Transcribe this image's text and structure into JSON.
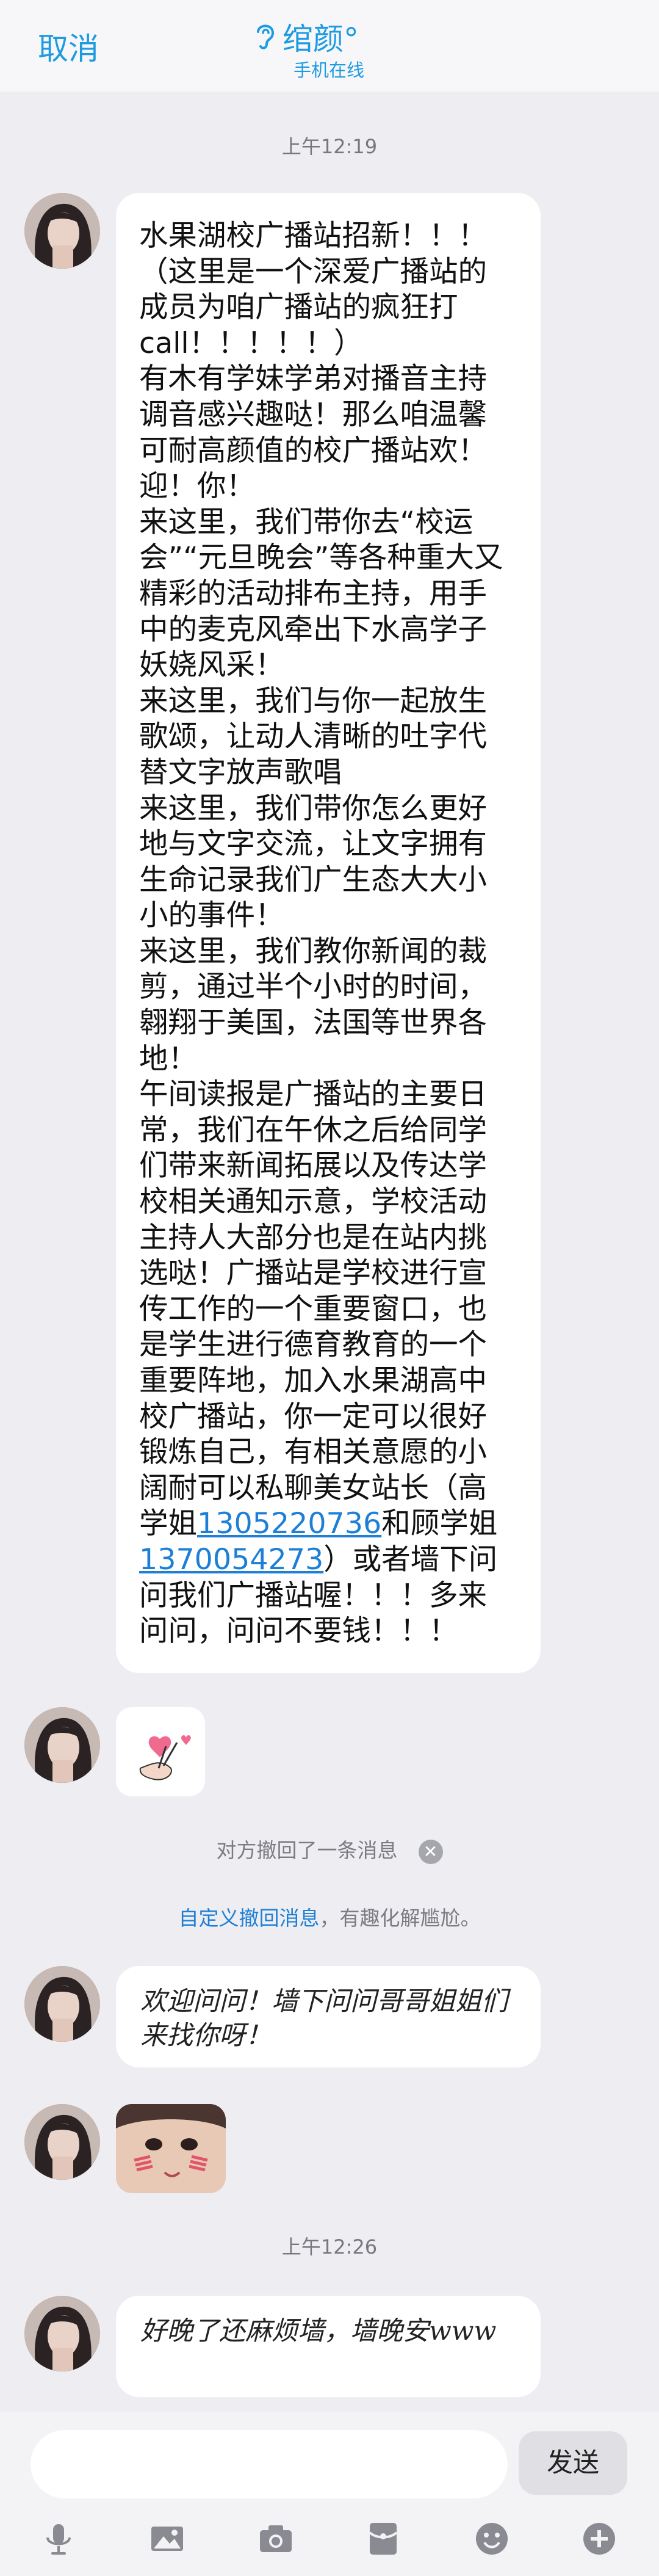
{
  "header": {
    "cancel_label": "取消",
    "contact_name": "绾颜°",
    "contact_status": "手机在线",
    "accent_color": "#1e9be0"
  },
  "times": [
    "上午12:19",
    "上午12:26"
  ],
  "messages": {
    "main_lines": [
      "水果湖校广播站招新！！！",
      "（这里是一个深爱广播站的",
      "成员为咱广播站的疯狂打",
      "call！！！！！）",
      "有木有学妹学弟对播音主持",
      "调音感兴趣哒！那么咱温馨",
      "可耐高颜值的校广播站欢！",
      "迎！你！",
      "来这里，我们带你去“校运",
      "会”“元旦晚会”等各种重大又",
      "精彩的活动排布主持，用手",
      "中的麦克风牵出下水高学子",
      "妖娆风采！",
      "来这里，我们与你一起放生",
      "歌颂，让动人清晰的吐字代",
      "替文字放声歌唱",
      "来这里，我们带你怎么更好",
      "地与文字交流，让文字拥有",
      "生命记录我们广生态大大小",
      "小的事件！",
      "来这里，我们教你新闻的裁",
      "剪，通过半个小时的时间，",
      "翱翔于美国，法国等世界各",
      "地！",
      "午间读报是广播站的主要日",
      "常，我们在午休之后给同学",
      "们带来新闻拓展以及传达学",
      "校相关通知示意，学校活动",
      "主持人大部分也是在站内挑",
      "选哒！广播站是学校进行宣",
      "传工作的一个重要窗口，也",
      "是学生进行德育教育的一个",
      "重要阵地，加入水果湖高中",
      "校广播站，你一定可以很好",
      "锻炼自己，有相关意愿的小",
      "阔耐可以私聊美女站长（高"
    ],
    "line37_prefix": "学姐",
    "phone1": "1305220736",
    "line37_suffix": "和顾学姐",
    "phone2": "1370054273",
    "line38_suffix": "）或者墙下问",
    "tail_lines": [
      "问我们广播站喔！！！多来",
      "问问，问问不要钱！！！"
    ],
    "recall_notice": "对方撤回了一条消息",
    "custom_recall_link": "自定义撤回消息",
    "custom_recall_rest": "，有趣化解尴尬。",
    "welcome_text": "欢迎问问！墙下问问哥哥姐姐们来找你呀！",
    "late_text": "好晚了还麻烦墙，墙晚安www"
  },
  "input": {
    "placeholder": "",
    "send_label": "发送"
  },
  "toolbar_icons": [
    "mic-icon",
    "image-icon",
    "camera-icon",
    "red-packet-icon",
    "emoji-icon",
    "plus-icon"
  ]
}
